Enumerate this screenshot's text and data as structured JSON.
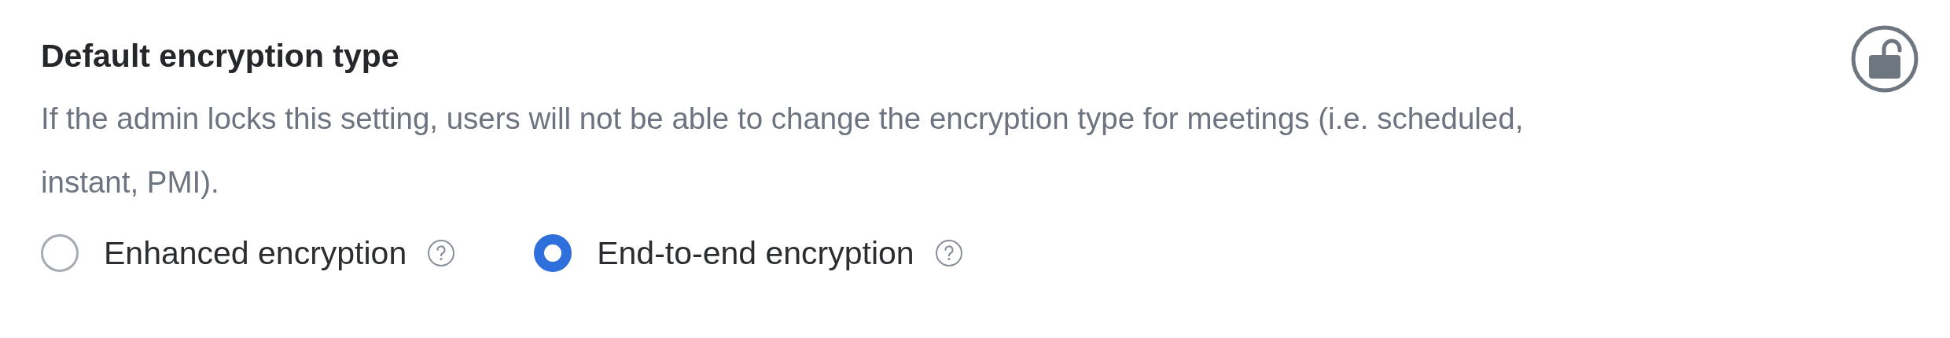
{
  "setting": {
    "title": "Default encryption type",
    "description": "If the admin locks this setting, users will not be able to change the encryption type for meetings (i.e. scheduled, instant, PMI).",
    "locked": false
  },
  "options": [
    {
      "label": "Enhanced encryption",
      "selected": false
    },
    {
      "label": "End-to-end encryption",
      "selected": true
    }
  ]
}
